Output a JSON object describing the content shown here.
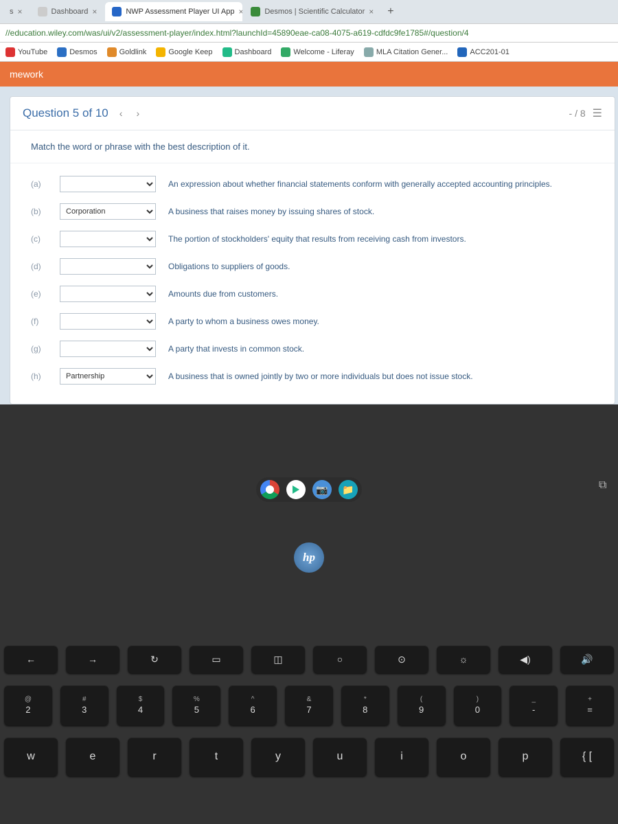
{
  "tabs": [
    {
      "title": "s",
      "active": false
    },
    {
      "title": "Dashboard",
      "active": false
    },
    {
      "title": "NWP Assessment Player UI App",
      "active": true
    },
    {
      "title": "Desmos | Scientific Calculator",
      "active": false
    }
  ],
  "url": "//education.wiley.com/was/ui/v2/assessment-player/index.html?launchId=45890eae-ca08-4075-a619-cdfdc9fe1785#/question/4",
  "bookmarks": [
    {
      "label": "YouTube"
    },
    {
      "label": "Desmos"
    },
    {
      "label": "Goldlink"
    },
    {
      "label": "Google Keep"
    },
    {
      "label": "Dashboard"
    },
    {
      "label": "Welcome - Liferay"
    },
    {
      "label": "MLA Citation Gener..."
    },
    {
      "label": "ACC201-01"
    }
  ],
  "page_header": "mework",
  "question": {
    "title": "Question 5 of 10",
    "score": "- / 8",
    "prompt": "Match the word or phrase with the best description of it."
  },
  "rows": [
    {
      "label": "(a)",
      "value": "",
      "desc": "An expression about whether financial statements conform with generally accepted accounting principles."
    },
    {
      "label": "(b)",
      "value": "Corporation",
      "desc": "A business that raises money by issuing shares of stock."
    },
    {
      "label": "(c)",
      "value": "",
      "desc": "The portion of stockholders' equity that results from receiving cash from investors."
    },
    {
      "label": "(d)",
      "value": "",
      "desc": "Obligations to suppliers of goods."
    },
    {
      "label": "(e)",
      "value": "",
      "desc": "Amounts due from customers."
    },
    {
      "label": "(f)",
      "value": "",
      "desc": "A party to whom a business owes money."
    },
    {
      "label": "(g)",
      "value": "",
      "desc": "A party that invests in common stock."
    },
    {
      "label": "(h)",
      "value": "Partnership",
      "desc": "A business that is owned jointly by two or more individuals but does not issue stock."
    }
  ],
  "fn_keys": [
    "←",
    "→",
    "↻",
    "▭",
    "◫",
    "○",
    "⊙",
    "☼",
    "◀)",
    "🔊"
  ],
  "num_row": [
    {
      "u": "@",
      "l": "2"
    },
    {
      "u": "#",
      "l": "3"
    },
    {
      "u": "$",
      "l": "4"
    },
    {
      "u": "%",
      "l": "5"
    },
    {
      "u": "^",
      "l": "6"
    },
    {
      "u": "&",
      "l": "7"
    },
    {
      "u": "*",
      "l": "8"
    },
    {
      "u": "(",
      "l": "9"
    },
    {
      "u": ")",
      "l": "0"
    },
    {
      "u": "_",
      "l": "-"
    },
    {
      "u": "+",
      "l": "="
    }
  ],
  "letter_row": [
    "w",
    "e",
    "r",
    "t",
    "y",
    "u",
    "i",
    "o",
    "p",
    "{ ["
  ],
  "logo_text": "hp"
}
